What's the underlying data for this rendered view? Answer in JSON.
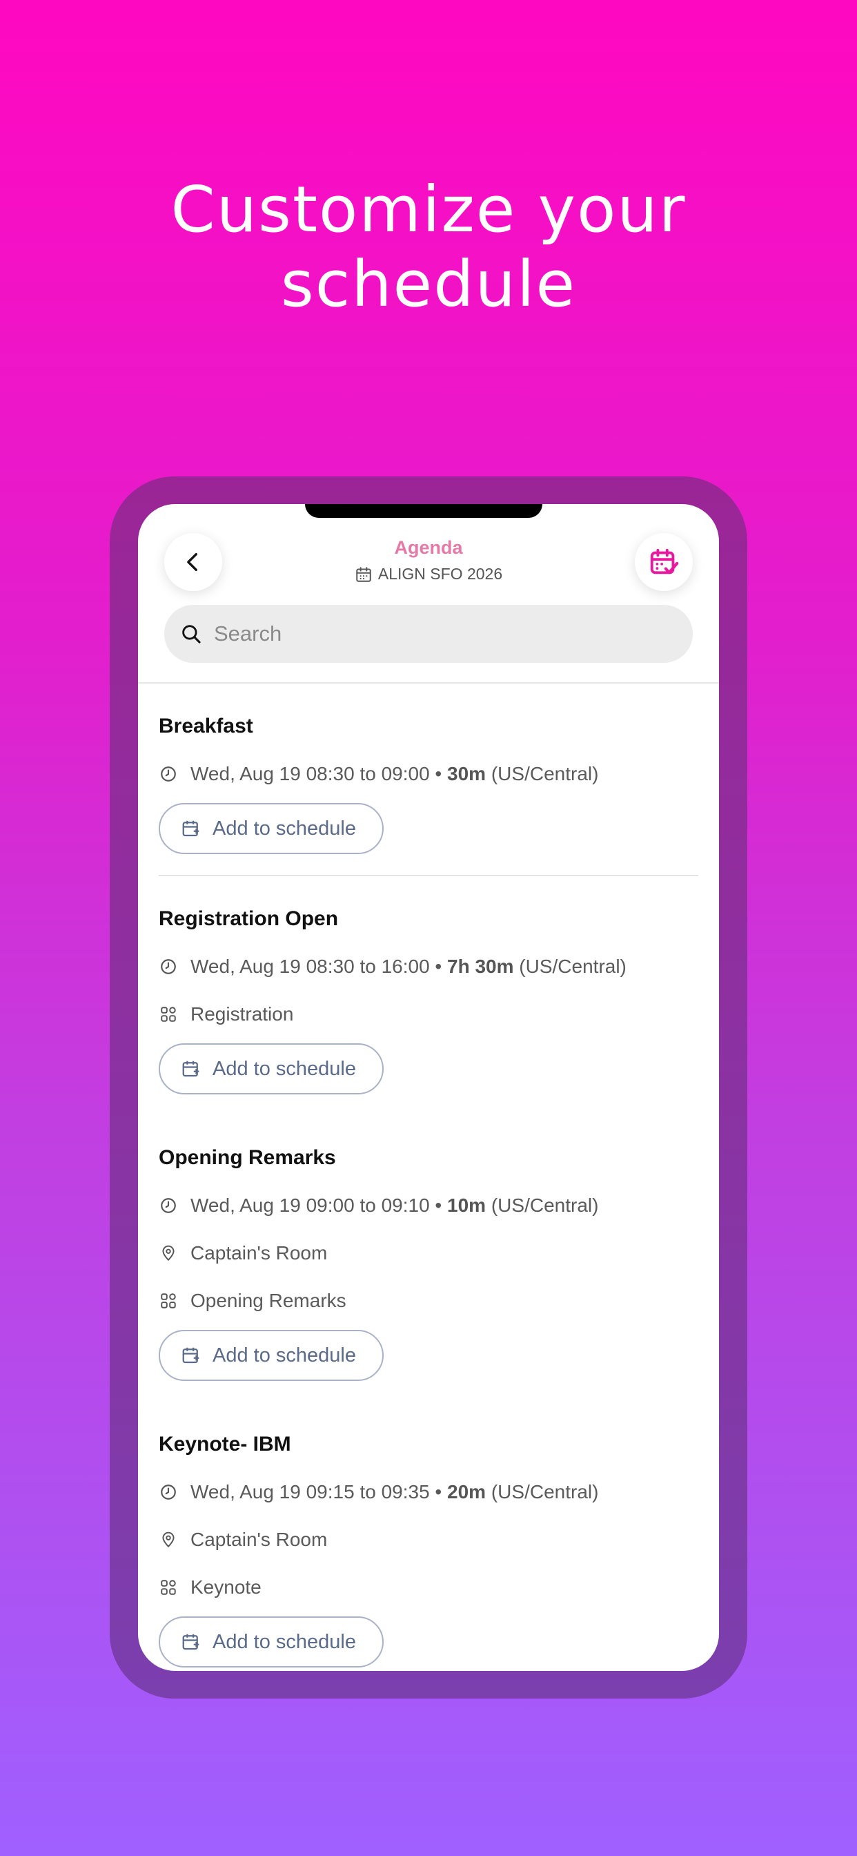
{
  "headline": {
    "line1": "Customize your",
    "line2": "schedule"
  },
  "header": {
    "title": "Agenda",
    "event_name": "ALIGN SFO 2026",
    "accent_color": "#e37aa8",
    "icons": {
      "back": "chevron-left-icon",
      "my_schedule": "calendar-check-icon",
      "event": "calendar-icon"
    }
  },
  "search": {
    "placeholder": "Search",
    "value": ""
  },
  "sessions": [
    {
      "title": "Breakfast",
      "time": "Wed, Aug 19 08:30 to 09:00 •",
      "duration": "30m",
      "timezone": "(US/Central)",
      "add_label": "Add to schedule"
    },
    {
      "title": "Registration Open",
      "time": "Wed, Aug 19 08:30 to 16:00 •",
      "duration": "7h 30m",
      "timezone": "(US/Central)",
      "category": "Registration",
      "add_label": "Add to schedule"
    },
    {
      "title": "Opening Remarks",
      "time": "Wed, Aug 19 09:00 to 09:10 •",
      "duration": "10m",
      "timezone": "(US/Central)",
      "location": "Captain's Room",
      "category": "Opening Remarks",
      "add_label": "Add to schedule"
    },
    {
      "title": "Keynote- IBM",
      "time": "Wed, Aug 19 09:15 to 09:35 •",
      "duration": "20m",
      "timezone": "(US/Central)",
      "location": "Captain's Room",
      "category": "Keynote",
      "add_label": "Add to schedule"
    }
  ]
}
